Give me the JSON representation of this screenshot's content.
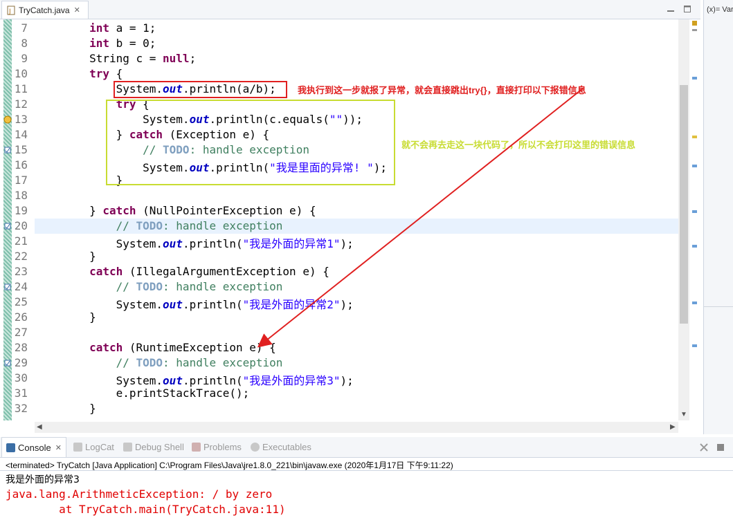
{
  "editor": {
    "tab_title": "TryCatch.java",
    "tab_close": "✕",
    "lines": [
      {
        "no": "7"
      },
      {
        "no": "8"
      },
      {
        "no": "9"
      },
      {
        "no": "10"
      },
      {
        "no": "11"
      },
      {
        "no": "12"
      },
      {
        "no": "13"
      },
      {
        "no": "14"
      },
      {
        "no": "15"
      },
      {
        "no": "16"
      },
      {
        "no": "17"
      },
      {
        "no": "18"
      },
      {
        "no": "19"
      },
      {
        "no": "20"
      },
      {
        "no": "21"
      },
      {
        "no": "22"
      },
      {
        "no": "23"
      },
      {
        "no": "24"
      },
      {
        "no": "25"
      },
      {
        "no": "26"
      },
      {
        "no": "27"
      },
      {
        "no": "28"
      },
      {
        "no": "29"
      },
      {
        "no": "30"
      },
      {
        "no": "31"
      },
      {
        "no": "32"
      }
    ],
    "code": {
      "l7a": "        ",
      "l7kw": "int",
      "l7b": " a = 1;",
      "l8a": "        ",
      "l8kw": "int",
      "l8b": " b = 0;",
      "l9": "        String c = ",
      "l9kw": "null",
      "l9b": ";",
      "l10a": "        ",
      "l10kw": "try",
      "l10b": " {",
      "l11a": "            System.",
      "l11fld": "out",
      "l11b": ".println(a/b);",
      "l12a": "            ",
      "l12kw": "try",
      "l12b": " {",
      "l13a": "                System.",
      "l13fld": "out",
      "l13b": ".println(c.equals(",
      "l13str": "\"\"",
      "l13c": "));",
      "l14a": "            } ",
      "l14kw": "catch",
      "l14b": " (Exception e) {",
      "l15a": "                ",
      "l15cmt": "// ",
      "l15todo": "TODO",
      "l15cmt2": ": handle exception",
      "l16a": "                System.",
      "l16fld": "out",
      "l16b": ".println(",
      "l16str": "\"我是里面的异常! \"",
      "l16c": ");",
      "l17": "            }",
      "l19a": "        } ",
      "l19kw": "catch",
      "l19b": " (NullPointerException e) {",
      "l20a": "            ",
      "l20cmt": "// ",
      "l20todo": "TODO",
      "l20cmt2": ": handle exception",
      "l21a": "            System.",
      "l21fld": "out",
      "l21b": ".println(",
      "l21str": "\"我是外面的异常1\"",
      "l21c": ");",
      "l22": "        }",
      "l23a": "        ",
      "l23kw": "catch",
      "l23b": " (IllegalArgumentException e) {",
      "l24a": "            ",
      "l24cmt": "// ",
      "l24todo": "TODO",
      "l24cmt2": ": handle exception",
      "l25a": "            System.",
      "l25fld": "out",
      "l25b": ".println(",
      "l25str": "\"我是外面的异常2\"",
      "l25c": ");",
      "l26": "        }",
      "l28a": "        ",
      "l28kw": "catch",
      "l28b": " (RuntimeException e) {",
      "l29a": "            ",
      "l29cmt": "// ",
      "l29todo": "TODO",
      "l29cmt2": ": handle exception",
      "l30a": "            System.",
      "l30fld": "out",
      "l30b": ".println(",
      "l30str": "\"我是外面的异常3\"",
      "l30c": ");",
      "l31": "            e.printStackTrace();",
      "l32": "        }"
    }
  },
  "annotations": {
    "red": "我执行到这一步就报了异常，就会直接跳出try{}，直接打印以下报错信息",
    "green": "就不会再去走这一块代码了，所以不会打印这里的错误信息"
  },
  "side_view": {
    "label": "(x)= Var"
  },
  "console_view": {
    "tabs": [
      {
        "label": "Console",
        "close": "✕"
      },
      {
        "label": "LogCat"
      },
      {
        "label": "Debug Shell"
      },
      {
        "label": "Problems"
      },
      {
        "label": "Executables"
      }
    ],
    "status": "<terminated> TryCatch [Java Application] C:\\Program Files\\Java\\jre1.8.0_221\\bin\\javaw.exe (2020年1月17日 下午9:11:22)",
    "output": [
      "我是外面的异常3",
      "java.lang.ArithmeticException: / by zero",
      "        at TryCatch.main(TryCatch.java:11)"
    ]
  },
  "colors": {
    "keyword": "#7f0055",
    "field": "#0000c0",
    "string": "#2a00ff",
    "comment": "#3f7f5f",
    "error_output": "#e00000",
    "annotation_red": "#e02020",
    "annotation_green": "#c8dc32"
  }
}
